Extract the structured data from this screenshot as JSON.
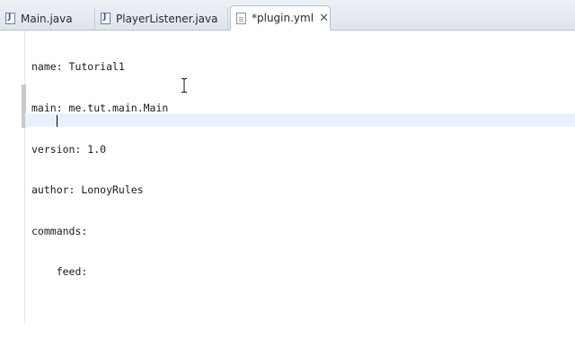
{
  "tabs": [
    {
      "label": "Main.java",
      "icon": "java-file-icon",
      "active": false
    },
    {
      "label": "PlayerListener.java",
      "icon": "java-file-icon",
      "active": false
    },
    {
      "label": "*plugin.yml",
      "icon": "text-file-icon",
      "active": true,
      "close": "✕"
    }
  ],
  "editor": {
    "lines": [
      "name: Tutorial1",
      "main: me.tut.main.Main",
      "version: 1.0",
      "author: LonoyRules",
      "commands:",
      "    feed:",
      "    "
    ]
  }
}
